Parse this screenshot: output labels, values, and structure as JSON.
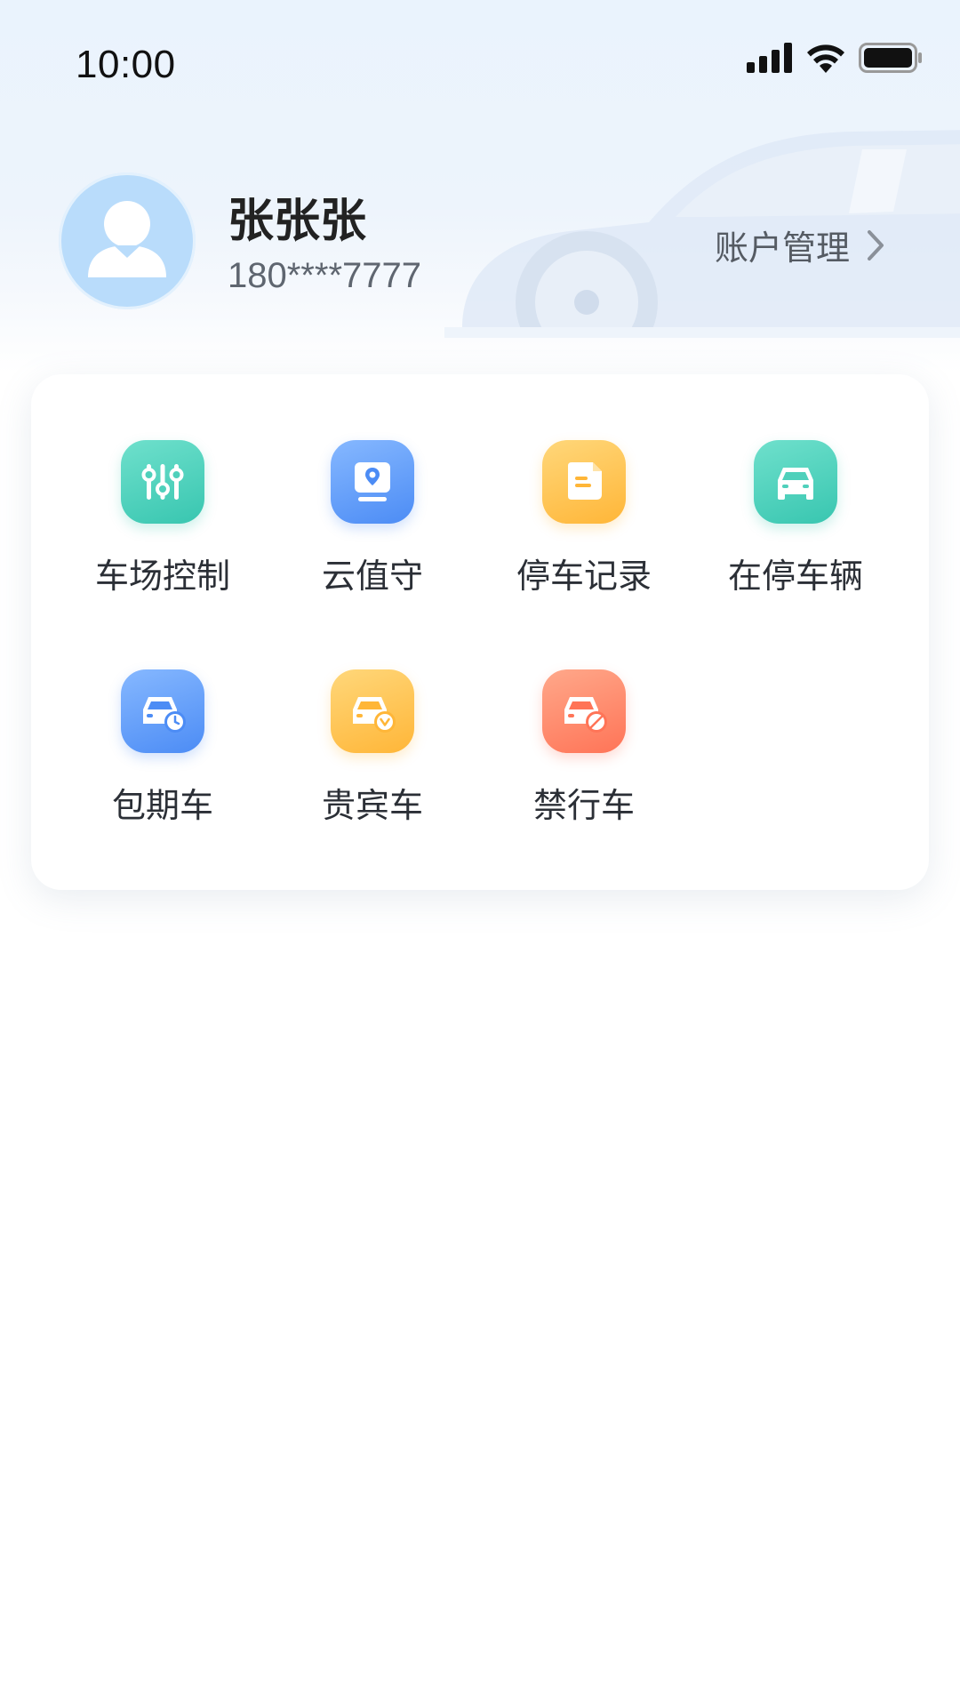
{
  "status_bar": {
    "time": "10:00"
  },
  "profile": {
    "name": "张张张",
    "phone": "180****7777",
    "account_link_label": "账户管理"
  },
  "menu": {
    "items": [
      {
        "label": "车场控制",
        "icon": "sliders-icon",
        "color": "#38c6b0"
      },
      {
        "label": "云值守",
        "icon": "monitor-location-icon",
        "color": "#4c8cf5"
      },
      {
        "label": "停车记录",
        "icon": "record-note-icon",
        "color": "#ffb638"
      },
      {
        "label": "在停车辆",
        "icon": "car-icon",
        "color": "#38c6b0"
      },
      {
        "label": "包期车",
        "icon": "car-clock-icon",
        "color": "#4c8cf5"
      },
      {
        "label": "贵宾车",
        "icon": "car-vip-icon",
        "color": "#ffb638"
      },
      {
        "label": "禁行车",
        "icon": "car-banned-icon",
        "color": "#ff7457"
      }
    ]
  }
}
